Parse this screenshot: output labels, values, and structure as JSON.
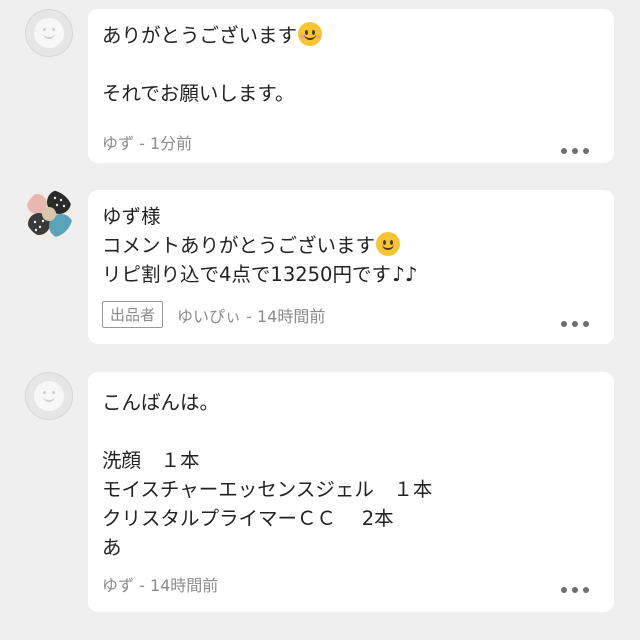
{
  "comments": [
    {
      "author": "ゆず",
      "lines": [
        "ありがとうございます",
        "",
        "それでお願いします。"
      ],
      "time": "1分前",
      "meta": "ゆず - 1分前",
      "is_seller": false
    },
    {
      "author": "ゆいぴぃ",
      "lines": [
        "ゆず様",
        "コメントありがとうございます",
        "リピ割り込で4点で13250円です"
      ],
      "time": "14時間前",
      "meta": "ゆいぴぃ - 14時間前",
      "is_seller": true,
      "seller_badge": "出品者"
    },
    {
      "author": "ゆず",
      "lines": [
        "こんばんは。",
        "",
        "洗顔　１本",
        "モイスチャーエッセンスジェル　１本",
        "クリスタルプライマーＣＣ　 2本",
        "あ"
      ],
      "time": "14時間前",
      "meta": "ゆず - 14時間前",
      "is_seller": false
    }
  ],
  "icons": {
    "more": "more-horizontal-icon",
    "emoji_smile": "smiling-face-icon",
    "emoji_slight": "slightly-smiling-face-icon",
    "notes": "musical-notes-icon"
  },
  "colors": {
    "background": "#efefef",
    "card": "#ffffff",
    "meta_text": "#8c8c8c"
  }
}
